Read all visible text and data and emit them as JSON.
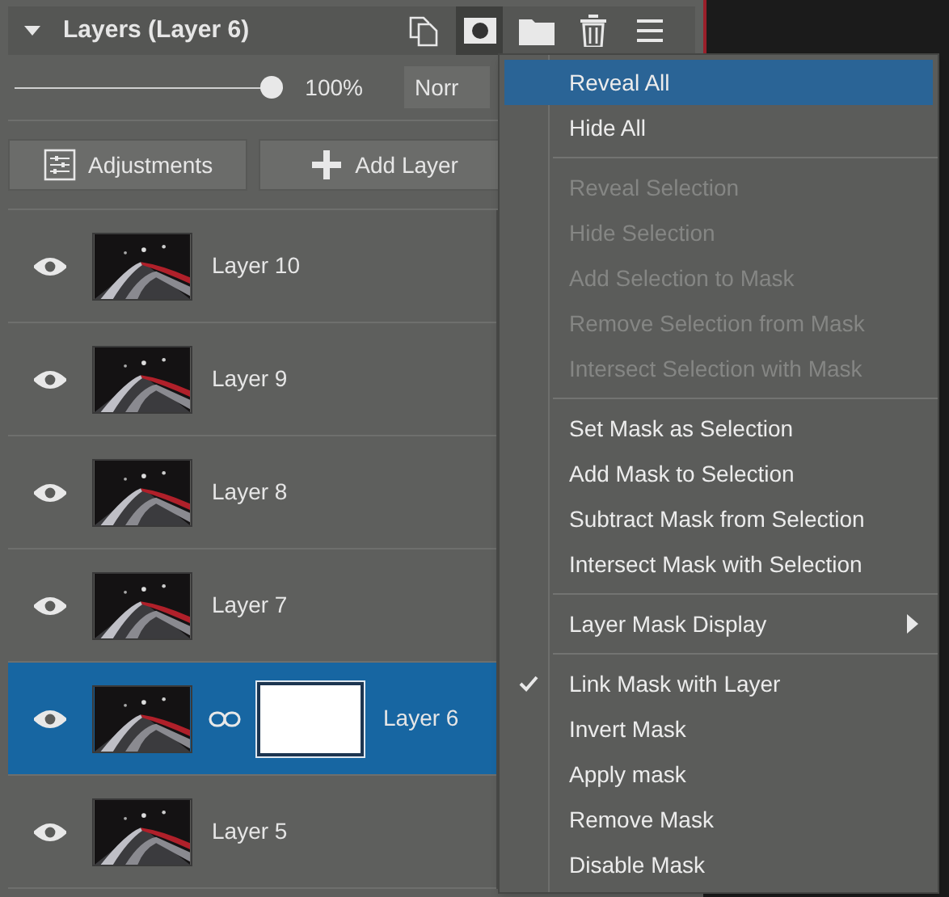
{
  "panel": {
    "title": "Layers (Layer 6)",
    "expanded": true
  },
  "toolbar": [
    {
      "kind": "duplicate",
      "selected": false
    },
    {
      "kind": "mask",
      "selected": true
    },
    {
      "kind": "folder",
      "selected": false
    },
    {
      "kind": "trash",
      "selected": false
    },
    {
      "kind": "menu",
      "selected": false
    }
  ],
  "opacity": {
    "level": 1,
    "reading": "100%"
  },
  "blend_mode": {
    "value": "Norr"
  },
  "buttons": [
    {
      "kind": "adjustments",
      "label": "Adjustments"
    },
    {
      "kind": "add",
      "label": "Add Layer"
    }
  ],
  "layers": [
    {
      "name": "Layer 10",
      "visible": true,
      "selected": false,
      "mask": false
    },
    {
      "name": "Layer 9",
      "visible": true,
      "selected": false,
      "mask": false
    },
    {
      "name": "Layer 8",
      "visible": true,
      "selected": false,
      "mask": false
    },
    {
      "name": "Layer 7",
      "visible": true,
      "selected": false,
      "mask": false
    },
    {
      "name": "Layer 6",
      "visible": true,
      "selected": true,
      "mask": true
    },
    {
      "name": "Layer 5",
      "visible": true,
      "selected": false,
      "mask": false
    }
  ],
  "menu": [
    {
      "kind": "item",
      "label": "Reveal All",
      "selected": true,
      "disabled": false,
      "checked": false
    },
    {
      "kind": "item",
      "label": "Hide All",
      "selected": false,
      "disabled": false,
      "checked": false
    },
    {
      "kind": "separator"
    },
    {
      "kind": "item",
      "label": "Reveal Selection",
      "selected": false,
      "disabled": true,
      "checked": false
    },
    {
      "kind": "item",
      "label": "Hide Selection",
      "selected": false,
      "disabled": true,
      "checked": false
    },
    {
      "kind": "item",
      "label": "Add Selection to Mask",
      "selected": false,
      "disabled": true,
      "checked": false
    },
    {
      "kind": "item",
      "label": "Remove Selection from Mask",
      "selected": false,
      "disabled": true,
      "checked": false
    },
    {
      "kind": "item",
      "label": "Intersect Selection with Mask",
      "selected": false,
      "disabled": true,
      "checked": false
    },
    {
      "kind": "separator"
    },
    {
      "kind": "item",
      "label": "Set Mask as Selection",
      "selected": false,
      "disabled": false,
      "checked": false
    },
    {
      "kind": "item",
      "label": "Add Mask to Selection",
      "selected": false,
      "disabled": false,
      "checked": false
    },
    {
      "kind": "item",
      "label": "Subtract Mask from Selection",
      "selected": false,
      "disabled": false,
      "checked": false
    },
    {
      "kind": "item",
      "label": "Intersect Mask with Selection",
      "selected": false,
      "disabled": false,
      "checked": false
    },
    {
      "kind": "separator"
    },
    {
      "kind": "submenu",
      "label": "Layer Mask Display",
      "selected": false,
      "disabled": false,
      "checked": false
    },
    {
      "kind": "separator"
    },
    {
      "kind": "item",
      "label": "Link Mask with Layer",
      "selected": false,
      "disabled": false,
      "checked": true
    },
    {
      "kind": "item",
      "label": "Invert Mask",
      "selected": false,
      "disabled": false,
      "checked": false
    },
    {
      "kind": "item",
      "label": "Apply mask",
      "selected": false,
      "disabled": false,
      "checked": false
    },
    {
      "kind": "item",
      "label": "Remove Mask",
      "selected": false,
      "disabled": false,
      "checked": false
    },
    {
      "kind": "item",
      "label": "Disable Mask",
      "selected": false,
      "disabled": false,
      "checked": false
    }
  ]
}
